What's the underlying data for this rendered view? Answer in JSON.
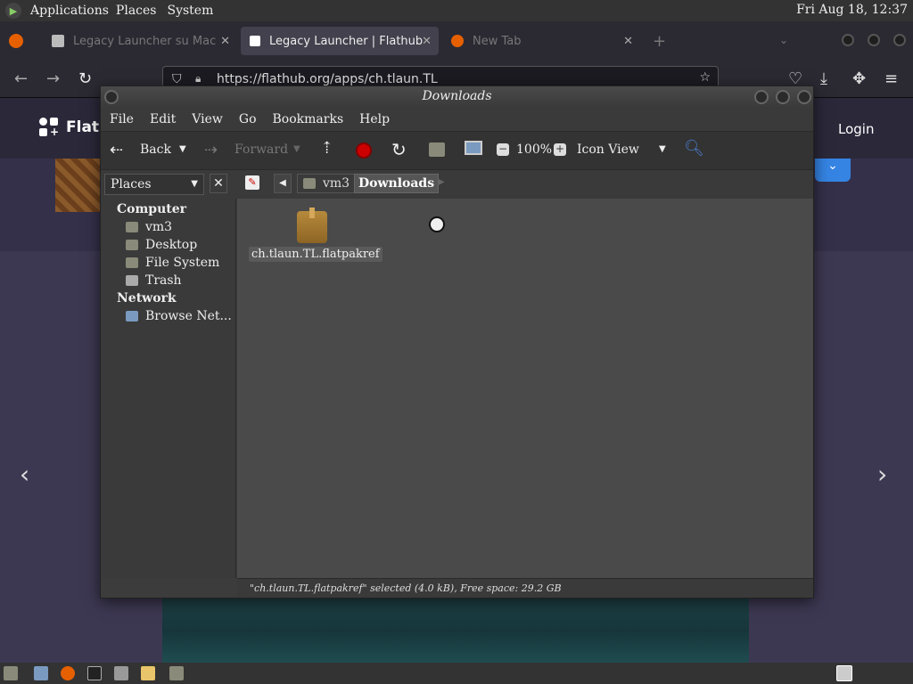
{
  "panel": {
    "menus": [
      "Applications",
      "Places",
      "System"
    ],
    "clock": "Fri Aug 18, 12:37"
  },
  "firefox": {
    "tabs": [
      {
        "title": "Legacy Launcher su Mac"
      },
      {
        "title": "Legacy Launcher | Flathub"
      },
      {
        "title": "New Tab"
      }
    ],
    "url": "https://flathub.org/apps/ch.tlaun.TL"
  },
  "flathub": {
    "logo_text": "Flath",
    "login_label": "Login"
  },
  "nautilus": {
    "title": "Downloads",
    "menubar": [
      "File",
      "Edit",
      "View",
      "Go",
      "Bookmarks",
      "Help"
    ],
    "toolbar": {
      "back": "Back",
      "forward": "Forward",
      "zoom": "100%",
      "view_mode": "Icon View"
    },
    "location": {
      "parent": "vm3",
      "current": "Downloads"
    },
    "sidebar": {
      "header": "Places",
      "sections": [
        {
          "title": "Computer",
          "items": [
            "vm3",
            "Desktop",
            "File System",
            "Trash"
          ]
        },
        {
          "title": "Network",
          "items": [
            "Browse Net..."
          ]
        }
      ]
    },
    "files": [
      {
        "name": "ch.tlaun.TL.flatpakref"
      }
    ],
    "status": "\"ch.tlaun.TL.flatpakref\" selected (4.0 kB), Free space: 29.2 GB"
  },
  "colors": {
    "accent_blue": "#3584e4",
    "window_bg": "#4a4a4a"
  }
}
